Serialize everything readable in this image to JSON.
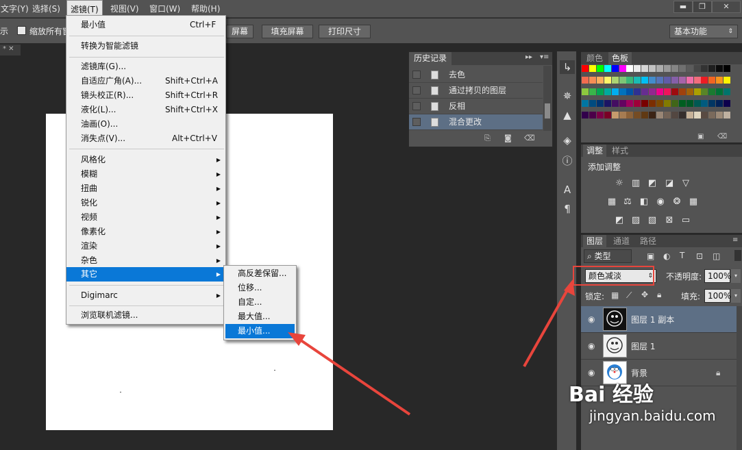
{
  "menubar": {
    "items": [
      "文字(Y)",
      "选择(S)",
      "滤镜(T)",
      "视图(V)",
      "窗口(W)",
      "帮助(H)"
    ],
    "window_buttons": [
      "▬",
      "❐",
      "✕"
    ]
  },
  "options": {
    "left_fragment": "示",
    "checkbox_label": "缩放所有窗",
    "btn_fit_fragment": "屏幕",
    "btn_fill": "填充屏幕",
    "btn_print": "打印尺寸",
    "workspace": "基本功能"
  },
  "doc_tab": {
    "label": "* ✕"
  },
  "filter_menu": {
    "items": [
      {
        "label": "最小值",
        "shortcut": "Ctrl+F"
      },
      {
        "label": "转换为智能滤镜",
        "shortcut": ""
      },
      {
        "label": "滤镜库(G)...",
        "shortcut": ""
      },
      {
        "label": "自适应广角(A)...",
        "shortcut": "Shift+Ctrl+A"
      },
      {
        "label": "镜头校正(R)...",
        "shortcut": "Shift+Ctrl+R"
      },
      {
        "label": "液化(L)...",
        "shortcut": "Shift+Ctrl+X"
      },
      {
        "label": "油画(O)...",
        "shortcut": ""
      },
      {
        "label": "消失点(V)...",
        "shortcut": "Alt+Ctrl+V"
      },
      {
        "label": "风格化",
        "shortcut": ""
      },
      {
        "label": "模糊",
        "shortcut": ""
      },
      {
        "label": "扭曲",
        "shortcut": ""
      },
      {
        "label": "锐化",
        "shortcut": ""
      },
      {
        "label": "视频",
        "shortcut": ""
      },
      {
        "label": "像素化",
        "shortcut": ""
      },
      {
        "label": "渲染",
        "shortcut": ""
      },
      {
        "label": "杂色",
        "shortcut": ""
      },
      {
        "label": "其它",
        "shortcut": ""
      },
      {
        "label": "Digimarc",
        "shortcut": ""
      },
      {
        "label": "浏览联机滤镜...",
        "shortcut": ""
      }
    ]
  },
  "submenu": {
    "items": [
      "高反差保留...",
      "位移...",
      "自定...",
      "最大值...",
      "最小值..."
    ]
  },
  "history": {
    "title": "历史记录",
    "items": [
      "去色",
      "通过拷贝的图层",
      "反相",
      "混合更改"
    ]
  },
  "swatches": {
    "tabs": [
      "颜色",
      "色板"
    ],
    "colors": [
      "#ff0000",
      "#ffff00",
      "#00ff00",
      "#00ffff",
      "#0000ff",
      "#ff00ff",
      "#ffffff",
      "#ebebeb",
      "#d6d6d6",
      "#c2c2c2",
      "#adadad",
      "#999999",
      "#858585",
      "#707070",
      "#5c5c5c",
      "#474747",
      "#333333",
      "#1f1f1f",
      "#0a0a0a",
      "#000000",
      "#f26c4f",
      "#f68e55",
      "#fbaf5d",
      "#fff467",
      "#acd372",
      "#7cc576",
      "#3bb878",
      "#1abbb4",
      "#00bff3",
      "#438ccb",
      "#5574b9",
      "#605ca8",
      "#855fa8",
      "#a763a8",
      "#f06ea9",
      "#f26d7d",
      "#ed1c24",
      "#f26522",
      "#f7941d",
      "#fff200",
      "#8dc73f",
      "#39b54a",
      "#00a651",
      "#00a99d",
      "#00aeef",
      "#0072bc",
      "#0054a6",
      "#2e3192",
      "#662d91",
      "#92278f",
      "#ec008c",
      "#ed145b",
      "#9e0b0f",
      "#a0410d",
      "#a36209",
      "#aba000",
      "#598527",
      "#1a7b30",
      "#007236",
      "#00746b",
      "#0076a3",
      "#004b80",
      "#003471",
      "#1b1464",
      "#440e62",
      "#630460",
      "#9e005d",
      "#9e0039",
      "#790000",
      "#7b2e00",
      "#7d4900",
      "#827b00",
      "#406618",
      "#005e20",
      "#005826",
      "#005952",
      "#005b7f",
      "#003663",
      "#002157",
      "#0d004c",
      "#32004b",
      "#4b0049",
      "#7b0046",
      "#7a0026",
      "#c69c6d",
      "#a67c52",
      "#8c6239",
      "#754c24",
      "#603913",
      "#3c2415",
      "#998675",
      "#736357",
      "#534741",
      "#362f2d",
      "#c7b299",
      "#e0d6c0",
      "#594a42",
      "#7a6a5c",
      "#9c8a78",
      "#beb0a0"
    ]
  },
  "adjustments": {
    "tabs": [
      "调整",
      "样式"
    ],
    "heading": "添加调整",
    "row1": [
      "brightness-icon",
      "levels-icon",
      "curves-icon",
      "exposure-icon",
      "vibrance-icon"
    ],
    "row2": [
      "hue-saturation-icon",
      "color-balance-icon",
      "black-white-icon",
      "photo-filter-icon",
      "channel-mixer-icon",
      "color-lookup-icon"
    ],
    "row3": [
      "invert-icon",
      "posterize-icon",
      "threshold-icon",
      "selective-color-icon",
      "gradient-map-icon"
    ]
  },
  "layers": {
    "tabs": [
      "图层",
      "通道",
      "路径"
    ],
    "filter": "类型",
    "blend_mode": "颜色减淡",
    "opacity_label": "不透明度:",
    "opacity": "100%",
    "lock_label": "锁定:",
    "fill_label": "填充:",
    "fill": "100%",
    "items": [
      {
        "name": "图层 1 副本"
      },
      {
        "name": "图层 1"
      },
      {
        "name": "背景"
      }
    ]
  },
  "watermark": {
    "brand": "Bai 经验",
    "url": "jingyan.baidu.com"
  },
  "colors": {
    "highlight": "#0a78d7",
    "annotation": "#e8453c"
  }
}
